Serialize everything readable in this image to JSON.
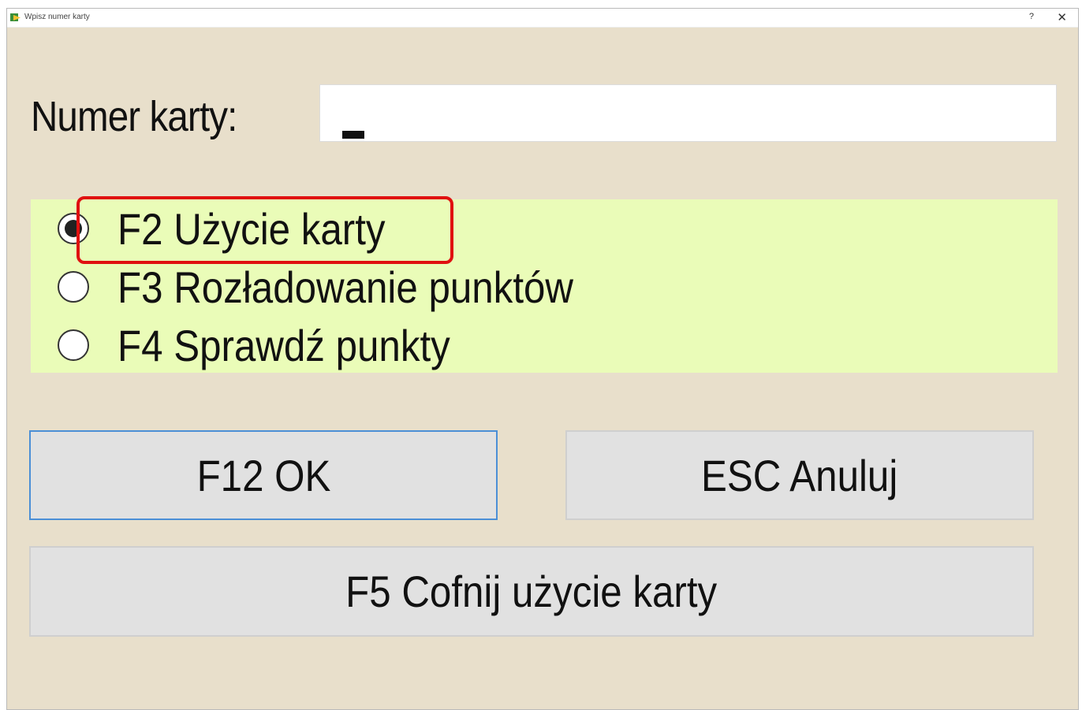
{
  "window": {
    "title": "Wpisz numer karty",
    "help": "?",
    "close": "✕"
  },
  "card": {
    "label": "Numer karty:",
    "value": ""
  },
  "options": [
    {
      "label": "F2 Użycie karty",
      "selected": true
    },
    {
      "label": "F3 Rozładowanie punktów",
      "selected": false
    },
    {
      "label": "F4 Sprawdź punkty",
      "selected": false
    }
  ],
  "buttons": {
    "ok": "F12 OK",
    "cancel": "ESC Anuluj",
    "undo": "F5 Cofnij użycie karty"
  },
  "colors": {
    "window_bg": "#e8dfcb",
    "options_bg": "#eafcb8",
    "highlight": "#e01010",
    "focus_border": "#4b8fd6"
  }
}
